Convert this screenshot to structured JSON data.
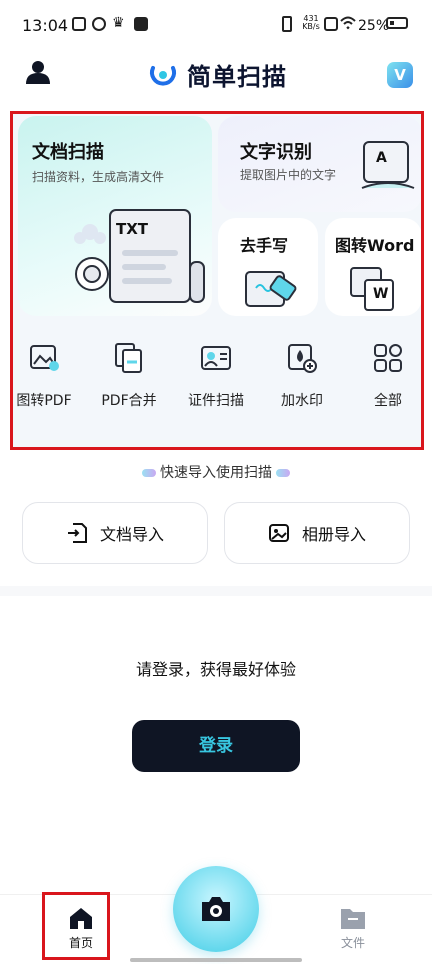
{
  "status_bar": {
    "time": "13:04",
    "net_speed_value": "431",
    "net_speed_unit": "KB/s",
    "battery": "25%"
  },
  "header": {
    "app_title": "简单扫描",
    "vip_label": "V"
  },
  "features": {
    "doc_scan": {
      "title": "文档扫描",
      "subtitle": "扫描资料，生成高清文件",
      "illustration_text": "TXT"
    },
    "text_ocr": {
      "title": "文字识别",
      "subtitle": "提取图片中的文字",
      "illustration_text": "A"
    },
    "remove_handwriting": {
      "title": "去手写"
    },
    "image_to_word": {
      "title": "图转Word",
      "illustration_text": "W"
    }
  },
  "tools": [
    {
      "label": "图转PDF",
      "icon": "image-pdf-icon"
    },
    {
      "label": "PDF合并",
      "icon": "pdf-merge-icon"
    },
    {
      "label": "证件扫描",
      "icon": "id-card-icon"
    },
    {
      "label": "加水印",
      "icon": "watermark-icon"
    },
    {
      "label": "全部",
      "icon": "grid-icon"
    }
  ],
  "quick_import": {
    "hint": "快速导入使用扫描",
    "doc_import": "文档导入",
    "album_import": "相册导入"
  },
  "login_prompt": {
    "message": "请登录，获得最好体验",
    "button": "登录"
  },
  "tabbar": {
    "home": "首页",
    "files": "文件"
  },
  "colors": {
    "accent": "#38c6e0",
    "dark": "#0f1524",
    "highlight": "#d9161c"
  }
}
